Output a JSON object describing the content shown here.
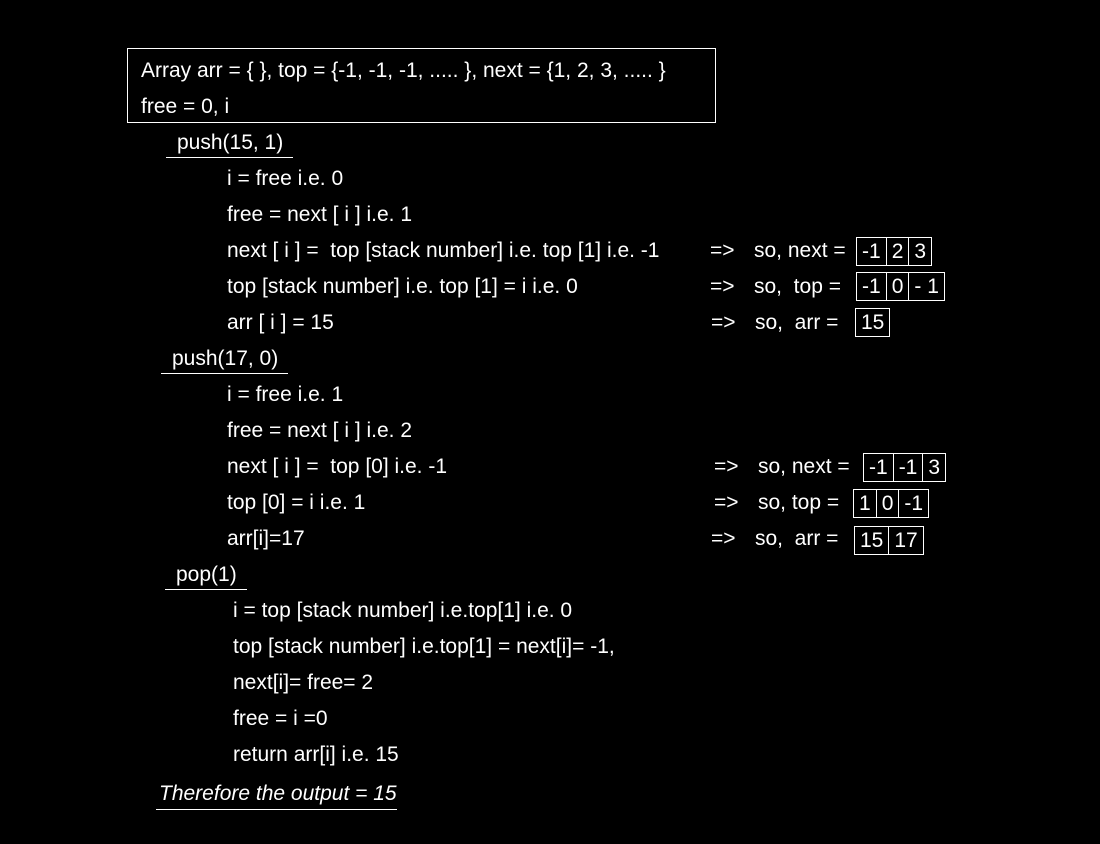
{
  "header": {
    "line1": "Array arr = { }, top = {-1, -1, -1, ..... }, next = {1, 2, 3, ..... }",
    "line2": "free = 0, i"
  },
  "push1": {
    "heading": "push(15, 1)",
    "steps": [
      "i = free i.e. 0",
      "free = next [ i ] i.e. 1",
      "next [ i ] =  top [stack number] i.e. top [1] i.e. -1",
      "top [stack number] i.e. top [1] = i i.e. 0",
      "arr [ i ] = 15"
    ],
    "results": [
      {
        "arrow": "=>",
        "label": "so, next =",
        "cells": [
          "-1",
          "2",
          "3"
        ]
      },
      {
        "arrow": "=>",
        "label": "so,  top =",
        "cells": [
          "-1",
          "0",
          "- 1"
        ]
      },
      {
        "arrow": "=>",
        "label": "so,  arr =",
        "cells": [
          "15"
        ]
      }
    ]
  },
  "push2": {
    "heading": "push(17, 0)",
    "steps": [
      "i = free i.e. 1",
      "free = next [ i ] i.e. 2",
      "next [ i ] =  top [0] i.e. -1",
      "top [0] = i i.e. 1",
      "arr[i]=17"
    ],
    "results": [
      {
        "arrow": "=>",
        "label": "so, next =",
        "cells": [
          "-1",
          "-1",
          "3"
        ]
      },
      {
        "arrow": "=>",
        "label": "so, top =",
        "cells": [
          "1",
          "0",
          "-1"
        ]
      },
      {
        "arrow": "=>",
        "label": "so,  arr =",
        "cells": [
          "15",
          "17"
        ]
      }
    ]
  },
  "pop": {
    "heading": "pop(1)",
    "steps": [
      "i = top [stack number] i.e.top[1] i.e. 0",
      "top [stack number] i.e.top[1] = next[i]= -1,",
      "next[i]= free= 2",
      "free = i =0",
      "return arr[i] i.e. 15"
    ]
  },
  "conclusion": "Therefore the output = 15"
}
